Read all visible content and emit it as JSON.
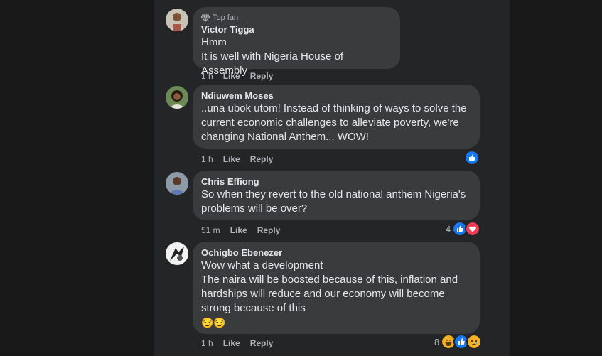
{
  "comments": [
    {
      "badge": "Top fan",
      "author": "Victor Tigga",
      "text": "Hmm\nIt is well with Nigeria House of Assembly",
      "time": "1 h",
      "like": "Like",
      "reply": "Reply",
      "reactions": {
        "count": "",
        "types": []
      }
    },
    {
      "badge": "",
      "author": "Ndiuwem Moses",
      "text": "..una ubok utom! Instead of thinking of ways to solve the\ncurrent economic challenges to alleviate poverty, we're\nchanging National Anthem... WOW!",
      "time": "1 h",
      "like": "Like",
      "reply": "Reply",
      "reactions": {
        "count": "",
        "types": [
          "like"
        ]
      }
    },
    {
      "badge": "",
      "author": "Chris Effiong",
      "text": "So when they revert to the old national anthem Nigeria's\nproblems will be over?",
      "time": "51 m",
      "like": "Like",
      "reply": "Reply",
      "reactions": {
        "count": "4",
        "types": [
          "like",
          "love"
        ]
      }
    },
    {
      "badge": "",
      "author": "Ochigbo Ebenezer",
      "text": "Wow what a development\nThe naira will be boosted because of this, inflation and\nhardships will reduce and our economy will become\nstrong because of this",
      "emoji_line": "😏😏",
      "time": "1 h",
      "like": "Like",
      "reply": "Reply",
      "reactions": {
        "count": "8",
        "types": [
          "haha",
          "like",
          "sad"
        ]
      }
    }
  ],
  "colors": {
    "page_bg": "#181818",
    "panel_bg": "#242526",
    "bubble_bg": "#3a3b3c",
    "text": "#e4e6eb",
    "secondary": "#b0b3b8",
    "like_blue": "#1877f2",
    "love_red": "#f33e58",
    "haha_yellow": "#f7b125"
  }
}
